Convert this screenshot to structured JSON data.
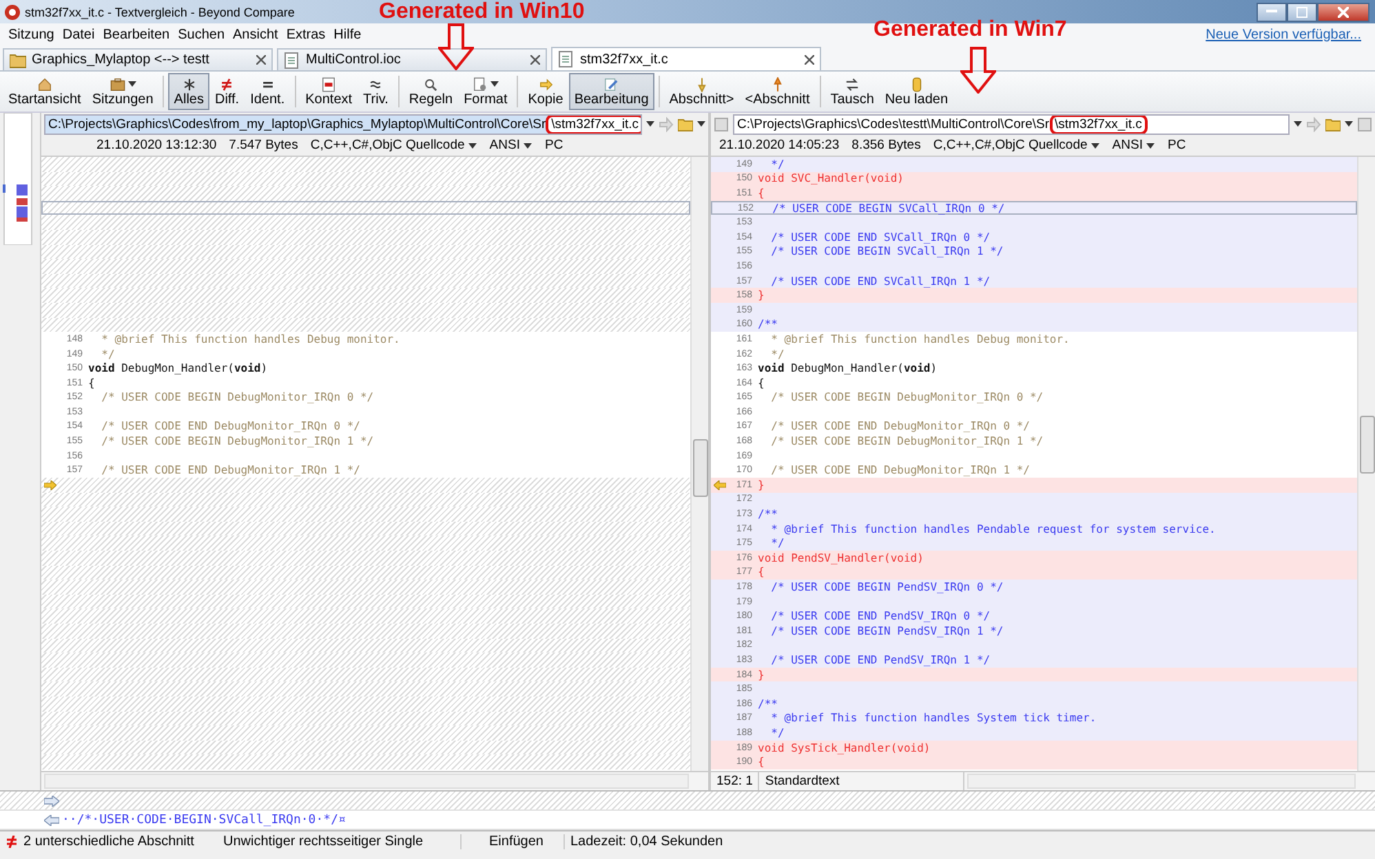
{
  "window": {
    "title": "stm32f7xx_it.c - Textvergleich - Beyond Compare"
  },
  "menu": [
    "Sitzung",
    "Datei",
    "Bearbeiten",
    "Suchen",
    "Ansicht",
    "Extras",
    "Hilfe"
  ],
  "update_link": "Neue Version verfügbar...",
  "tabs": [
    {
      "label": "Graphics_Mylaptop <--> testt",
      "selected": false
    },
    {
      "label": "MultiControl.ioc",
      "selected": false
    },
    {
      "label": "stm32f7xx_it.c",
      "selected": true
    }
  ],
  "toolbar": [
    [
      {
        "label": "Startansicht",
        "dropdown": false,
        "selected": false
      },
      {
        "label": "Sitzungen",
        "dropdown": true,
        "selected": false
      }
    ],
    [
      {
        "label": "Alles",
        "dropdown": false,
        "selected": true
      },
      {
        "label": "Diff.",
        "dropdown": false,
        "selected": false
      },
      {
        "label": "Ident.",
        "dropdown": false,
        "selected": false
      }
    ],
    [
      {
        "label": "Kontext",
        "dropdown": false,
        "selected": false
      },
      {
        "label": "Triv.",
        "dropdown": false,
        "selected": false
      }
    ],
    [
      {
        "label": "Regeln",
        "dropdown": false,
        "selected": false
      },
      {
        "label": "Format",
        "dropdown": true,
        "selected": false
      }
    ],
    [
      {
        "label": "Kopie",
        "dropdown": false,
        "selected": false
      },
      {
        "label": "Bearbeitung",
        "dropdown": false,
        "selected": true
      }
    ],
    [
      {
        "label": "Abschnitt>",
        "dropdown": false,
        "selected": false
      },
      {
        "label": "<Abschnitt",
        "dropdown": false,
        "selected": false
      }
    ],
    [
      {
        "label": "Tausch",
        "dropdown": false,
        "selected": false
      },
      {
        "label": "Neu laden",
        "dropdown": false,
        "selected": false
      }
    ]
  ],
  "left": {
    "path": "C:\\Projects\\Graphics\\Codes\\from_my_laptop\\Graphics_Mylaptop\\MultiControl\\Core\\Sr",
    "file": "\\stm32f7xx_it.c",
    "date": "21.10.2020 13:12:30",
    "size": "7.547 Bytes",
    "format": "C,C++,C#,ObjC Quellcode",
    "encoding": "ANSI",
    "line_ending": "PC",
    "lines": [
      {
        "kind": "missing",
        "current": false,
        "marker": false
      },
      {
        "kind": "missing",
        "current": false,
        "marker": false
      },
      {
        "kind": "missing",
        "current": false,
        "marker": false
      },
      {
        "kind": "missing",
        "current": true,
        "marker": false
      },
      {
        "kind": "missing",
        "current": false,
        "marker": false
      },
      {
        "kind": "missing",
        "current": false,
        "marker": false
      },
      {
        "kind": "missing",
        "current": false,
        "marker": false
      },
      {
        "kind": "missing",
        "current": false,
        "marker": false
      },
      {
        "kind": "missing",
        "current": false,
        "marker": false
      },
      {
        "kind": "missing",
        "current": false,
        "marker": false
      },
      {
        "kind": "missing",
        "current": false,
        "marker": false
      },
      {
        "kind": "missing",
        "current": false,
        "marker": false
      },
      {
        "kind": "comment",
        "number": "148",
        "text": "  * @brief This function handles Debug monitor.",
        "current": false,
        "marker": false
      },
      {
        "kind": "comment",
        "number": "149",
        "text": "  */",
        "current": false,
        "marker": false
      },
      {
        "kind": "code",
        "number": "150",
        "text": "**void** DebugMon_Handler(**void**)",
        "current": false,
        "marker": false
      },
      {
        "kind": "code",
        "number": "151",
        "text": "{",
        "current": false,
        "marker": false
      },
      {
        "kind": "comment",
        "number": "152",
        "text": "  /* USER CODE BEGIN DebugMonitor_IRQn 0 */",
        "current": false,
        "marker": false
      },
      {
        "kind": "comment",
        "number": "153",
        "current": false,
        "marker": false
      },
      {
        "kind": "comment",
        "number": "154",
        "text": "  /* USER CODE END DebugMonitor_IRQn 0 */",
        "current": false,
        "marker": false
      },
      {
        "kind": "comment",
        "number": "155",
        "text": "  /* USER CODE BEGIN DebugMonitor_IRQn 1 */",
        "current": false,
        "marker": false
      },
      {
        "kind": "comment",
        "number": "156",
        "current": false,
        "marker": false
      },
      {
        "kind": "comment",
        "number": "157",
        "text": "  /* USER CODE END DebugMonitor_IRQn 1 */",
        "current": false,
        "marker": false
      },
      {
        "kind": "missing",
        "current": false,
        "marker": true
      },
      {
        "kind": "missing",
        "current": false,
        "marker": false
      },
      {
        "kind": "missing",
        "current": false,
        "marker": false
      },
      {
        "kind": "missing",
        "current": false,
        "marker": false
      },
      {
        "kind": "missing",
        "current": false,
        "marker": false
      },
      {
        "kind": "missing",
        "current": false,
        "marker": false
      },
      {
        "kind": "missing",
        "current": false,
        "marker": false
      },
      {
        "kind": "missing",
        "current": false,
        "marker": false
      },
      {
        "kind": "missing",
        "current": false,
        "marker": false
      },
      {
        "kind": "missing",
        "current": false,
        "marker": false
      },
      {
        "kind": "missing",
        "current": false,
        "marker": false
      },
      {
        "kind": "missing",
        "current": false,
        "marker": false
      },
      {
        "kind": "missing",
        "current": false,
        "marker": false
      },
      {
        "kind": "missing",
        "current": false,
        "marker": false
      },
      {
        "kind": "missing",
        "current": false,
        "marker": false
      },
      {
        "kind": "missing",
        "current": false,
        "marker": false
      },
      {
        "kind": "missing",
        "current": false,
        "marker": false
      },
      {
        "kind": "missing",
        "current": false,
        "marker": false
      },
      {
        "kind": "missing",
        "current": false,
        "marker": false
      },
      {
        "kind": "missing",
        "current": false,
        "marker": false
      }
    ]
  },
  "right": {
    "path": "C:\\Projects\\Graphics\\Codes\\testt\\MultiControl\\Core\\Sr",
    "file": "\\stm32f7xx_it.c",
    "date": "21.10.2020 14:05:23",
    "size": "8.356 Bytes",
    "format": "C,C++,C#,ObjC Quellcode",
    "encoding": "ANSI",
    "line_ending": "PC",
    "position": "152: 1",
    "mode": "Standardtext",
    "lines": [
      {
        "kind": "minor",
        "number": "149",
        "text": "  */",
        "current": false,
        "marker": false
      },
      {
        "kind": "changed",
        "number": "150",
        "text": "void SVC_Handler(void)",
        "current": false,
        "marker": false
      },
      {
        "kind": "changed",
        "number": "151",
        "text": "{",
        "current": false,
        "marker": false
      },
      {
        "kind": "minor",
        "number": "152",
        "text": "  /* USER CODE BEGIN SVCall_IRQn 0 */",
        "current": true,
        "marker": false
      },
      {
        "kind": "minor",
        "number": "153",
        "current": false,
        "marker": false
      },
      {
        "kind": "minor",
        "number": "154",
        "text": "  /* USER CODE END SVCall_IRQn 0 */",
        "current": false,
        "marker": false
      },
      {
        "kind": "minor",
        "number": "155",
        "text": "  /* USER CODE BEGIN SVCall_IRQn 1 */",
        "current": false,
        "marker": false
      },
      {
        "kind": "minor",
        "number": "156",
        "current": false,
        "marker": false
      },
      {
        "kind": "minor",
        "number": "157",
        "text": "  /* USER CODE END SVCall_IRQn 1 */",
        "current": false,
        "marker": false
      },
      {
        "kind": "changed",
        "number": "158",
        "text": "}",
        "current": false,
        "marker": false
      },
      {
        "kind": "minor",
        "number": "159",
        "current": false,
        "marker": false
      },
      {
        "kind": "minor",
        "number": "160",
        "text": "/**",
        "current": false,
        "marker": false
      },
      {
        "kind": "comment",
        "number": "161",
        "text": "  * @brief This function handles Debug monitor.",
        "current": false,
        "marker": false
      },
      {
        "kind": "comment",
        "number": "162",
        "text": "  */",
        "current": false,
        "marker": false
      },
      {
        "kind": "code",
        "number": "163",
        "text": "**void** DebugMon_Handler(**void**)",
        "current": false,
        "marker": false
      },
      {
        "kind": "code",
        "number": "164",
        "text": "{",
        "current": false,
        "marker": false
      },
      {
        "kind": "comment",
        "number": "165",
        "text": "  /* USER CODE BEGIN DebugMonitor_IRQn 0 */",
        "current": false,
        "marker": false
      },
      {
        "kind": "comment",
        "number": "166",
        "current": false,
        "marker": false
      },
      {
        "kind": "comment",
        "number": "167",
        "text": "  /* USER CODE END DebugMonitor_IRQn 0 */",
        "current": false,
        "marker": false
      },
      {
        "kind": "comment",
        "number": "168",
        "text": "  /* USER CODE BEGIN DebugMonitor_IRQn 1 */",
        "current": false,
        "marker": false
      },
      {
        "kind": "comment",
        "number": "169",
        "current": false,
        "marker": false
      },
      {
        "kind": "comment",
        "number": "170",
        "text": "  /* USER CODE END DebugMonitor_IRQn 1 */",
        "current": false,
        "marker": false
      },
      {
        "kind": "changed",
        "number": "171",
        "text": "}",
        "current": false,
        "marker": true
      },
      {
        "kind": "minor",
        "number": "172",
        "current": false,
        "marker": false
      },
      {
        "kind": "minor",
        "number": "173",
        "text": "/**",
        "current": false,
        "marker": false
      },
      {
        "kind": "minor",
        "number": "174",
        "text": "  * @brief This function handles Pendable request for system service.",
        "current": false,
        "marker": false
      },
      {
        "kind": "minor",
        "number": "175",
        "text": "  */",
        "current": false,
        "marker": false
      },
      {
        "kind": "changed",
        "number": "176",
        "text": "void PendSV_Handler(void)",
        "current": false,
        "marker": false
      },
      {
        "kind": "changed",
        "number": "177",
        "text": "{",
        "current": false,
        "marker": false
      },
      {
        "kind": "minor",
        "number": "178",
        "text": "  /* USER CODE BEGIN PendSV_IRQn 0 */",
        "current": false,
        "marker": false
      },
      {
        "kind": "minor",
        "number": "179",
        "current": false,
        "marker": false
      },
      {
        "kind": "minor",
        "number": "180",
        "text": "  /* USER CODE END PendSV_IRQn 0 */",
        "current": false,
        "marker": false
      },
      {
        "kind": "minor",
        "number": "181",
        "text": "  /* USER CODE BEGIN PendSV_IRQn 1 */",
        "current": false,
        "marker": false
      },
      {
        "kind": "minor",
        "number": "182",
        "current": false,
        "marker": false
      },
      {
        "kind": "minor",
        "number": "183",
        "text": "  /* USER CODE END PendSV_IRQn 1 */",
        "current": false,
        "marker": false
      },
      {
        "kind": "changed",
        "number": "184",
        "text": "}",
        "current": false,
        "marker": false
      },
      {
        "kind": "minor",
        "number": "185",
        "current": false,
        "marker": false
      },
      {
        "kind": "minor",
        "number": "186",
        "text": "/**",
        "current": false,
        "marker": false
      },
      {
        "kind": "minor",
        "number": "187",
        "text": "  * @brief This function handles System tick timer.",
        "current": false,
        "marker": false
      },
      {
        "kind": "minor",
        "number": "188",
        "text": "  */",
        "current": false,
        "marker": false
      },
      {
        "kind": "changed",
        "number": "189",
        "text": "void SysTick_Handler(void)",
        "current": false,
        "marker": false
      },
      {
        "kind": "changed",
        "number": "190",
        "text": "{",
        "current": false,
        "marker": false
      }
    ]
  },
  "detail_lines": [
    {
      "kind": "missing"
    },
    {
      "kind": "text",
      "text": "··/*·USER·CODE·BEGIN·SVCall_IRQn·0·*/¤"
    }
  ],
  "status_bar": [
    "2 unterschiedliche Abschnitt",
    "Unwichtiger rechtsseitiger Single",
    "Einfügen",
    "Ladezeit: 0,04 Sekunden"
  ],
  "annotations": [
    {
      "text": "Generated in Win10"
    },
    {
      "text": "Generated in Win7"
    }
  ]
}
